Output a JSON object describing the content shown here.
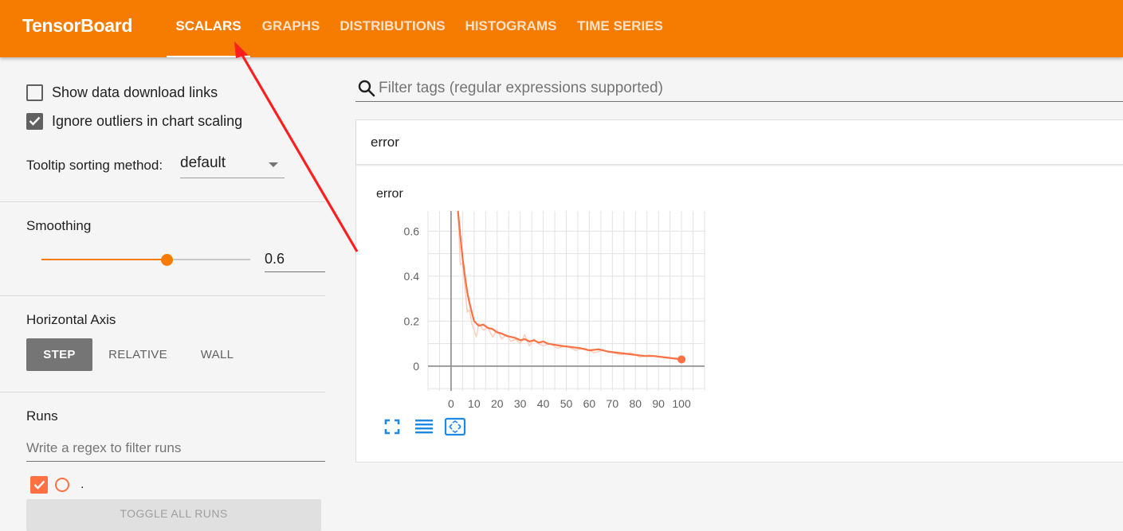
{
  "app": {
    "brand": "TensorBoard",
    "accent_color": "#f57c00"
  },
  "nav": {
    "tabs": [
      {
        "label": "SCALARS",
        "active": true
      },
      {
        "label": "GRAPHS",
        "active": false
      },
      {
        "label": "DISTRIBUTIONS",
        "active": false
      },
      {
        "label": "HISTOGRAMS",
        "active": false
      },
      {
        "label": "TIME SERIES",
        "active": false
      }
    ]
  },
  "sidebar": {
    "show_download_links": {
      "label": "Show data download links",
      "checked": false
    },
    "ignore_outliers": {
      "label": "Ignore outliers in chart scaling",
      "checked": true
    },
    "tooltip_sorting": {
      "label": "Tooltip sorting method:",
      "value": "default"
    },
    "smoothing": {
      "label": "Smoothing",
      "value": 0.6,
      "display": "0.6"
    },
    "horizontal_axis": {
      "label": "Horizontal Axis",
      "options": [
        "STEP",
        "RELATIVE",
        "WALL"
      ],
      "selected": "STEP"
    },
    "runs": {
      "label": "Runs",
      "filter_placeholder": "Write a regex to filter runs",
      "items": [
        {
          "name": ".",
          "checked": true,
          "color": "#ff7043"
        }
      ],
      "toggle_label": "TOGGLE ALL RUNS"
    }
  },
  "main": {
    "filter_placeholder": "Filter tags (regular expressions supported)",
    "card": {
      "header": "error",
      "chart_title": "error"
    }
  },
  "chart_data": {
    "type": "line",
    "title": "error",
    "xlabel": "",
    "ylabel": "",
    "xlim": [
      -10,
      110
    ],
    "ylim": [
      -0.11,
      0.69
    ],
    "x_ticks": [
      0,
      10,
      20,
      30,
      40,
      50,
      60,
      70,
      80,
      90,
      100
    ],
    "y_ticks": [
      0,
      0.2,
      0.4,
      0.6
    ],
    "y_tick_labels": [
      "0",
      "0.2",
      "0.4",
      "0.6"
    ],
    "grid": true,
    "series": [
      {
        "color": "#ff7043",
        "smoothed": true,
        "x": [
          3,
          4,
          5,
          6,
          7,
          8,
          9,
          10,
          12,
          14,
          16,
          18,
          20,
          22,
          24,
          26,
          28,
          30,
          32,
          34,
          36,
          38,
          40,
          42,
          45,
          48,
          52,
          56,
          60,
          64,
          68,
          72,
          76,
          80,
          84,
          88,
          92,
          96,
          100
        ],
        "values": [
          0.69,
          0.58,
          0.48,
          0.4,
          0.33,
          0.28,
          0.24,
          0.2,
          0.18,
          0.185,
          0.17,
          0.165,
          0.15,
          0.145,
          0.135,
          0.13,
          0.125,
          0.115,
          0.12,
          0.11,
          0.115,
          0.105,
          0.11,
          0.1,
          0.095,
          0.09,
          0.085,
          0.08,
          0.07,
          0.075,
          0.065,
          0.06,
          0.055,
          0.05,
          0.045,
          0.045,
          0.04,
          0.035,
          0.03
        ]
      },
      {
        "color": "#ffccbc",
        "smoothed": false,
        "x": [
          3,
          4,
          5,
          6,
          7,
          8,
          9,
          10,
          11,
          12,
          14,
          16,
          18,
          20,
          22,
          24,
          26,
          28,
          30,
          32,
          34,
          36,
          38,
          40,
          43,
          46,
          50,
          54,
          58,
          62,
          66,
          70,
          74,
          78,
          82,
          86,
          90,
          94,
          98,
          100
        ],
        "values": [
          0.69,
          0.45,
          0.46,
          0.35,
          0.24,
          0.25,
          0.19,
          0.16,
          0.13,
          0.19,
          0.16,
          0.17,
          0.13,
          0.16,
          0.12,
          0.14,
          0.11,
          0.12,
          0.1,
          0.14,
          0.09,
          0.12,
          0.1,
          0.09,
          0.1,
          0.08,
          0.09,
          0.07,
          0.08,
          0.06,
          0.07,
          0.06,
          0.05,
          0.06,
          0.04,
          0.05,
          0.04,
          0.04,
          0.03,
          0.03
        ]
      }
    ]
  }
}
